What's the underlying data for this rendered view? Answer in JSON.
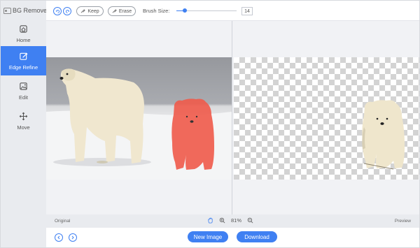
{
  "app": {
    "title": "BG Remover"
  },
  "sidebar": {
    "items": [
      {
        "label": "Home",
        "icon": "home-icon",
        "active": false
      },
      {
        "label": "Edge Refine",
        "icon": "edge-refine-icon",
        "active": true
      },
      {
        "label": "Edit",
        "icon": "edit-image-icon",
        "active": false
      },
      {
        "label": "Move",
        "icon": "move-icon",
        "active": false
      }
    ]
  },
  "toolbar": {
    "undo_icon": "undo-icon",
    "redo_icon": "redo-icon",
    "keep_label": "Keep",
    "erase_label": "Erase",
    "brush_label": "Brush Size:",
    "brush_value": "14",
    "brush_level": 0.14
  },
  "canvas": {
    "original_label": "Original",
    "preview_label": "Preview"
  },
  "zoom": {
    "value": "81%"
  },
  "bottom": {
    "new_image_label": "New Image",
    "download_label": "Download"
  },
  "colors": {
    "accent": "#3f80f2",
    "keep_overlay": "#f05a4a",
    "sidebar_bg": "#e9ebef"
  }
}
